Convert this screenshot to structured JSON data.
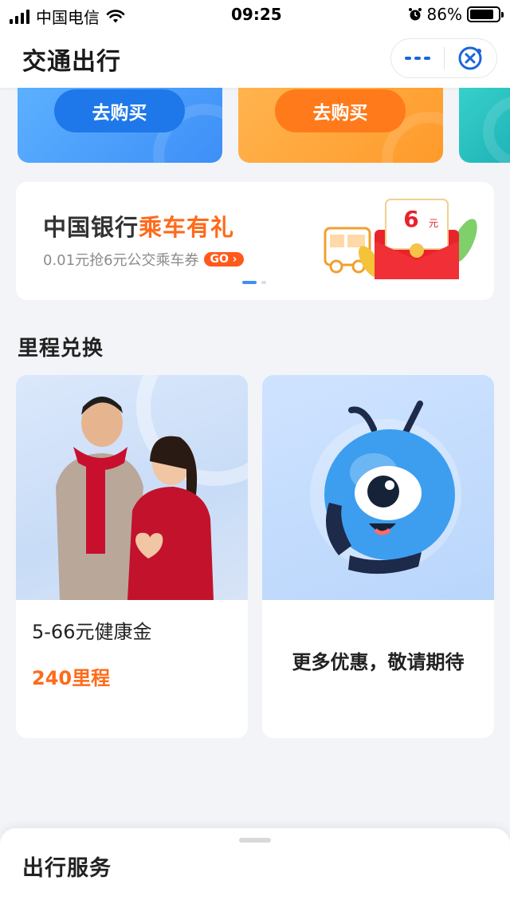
{
  "status_bar": {
    "carrier": "中国电信",
    "time": "09:25",
    "battery_percent": "86%",
    "battery_level": 0.86,
    "icons": [
      "signal-icon",
      "wifi-icon",
      "alarm-icon",
      "battery-icon"
    ]
  },
  "header": {
    "title": "交通出行",
    "more_icon": "more-dots-icon",
    "close_icon": "close-miniprogram-icon",
    "accent": "#1b66d9"
  },
  "tickets": [
    {
      "button_label": "去购买",
      "color": "#3d8ff7"
    },
    {
      "button_label": "去购买",
      "color": "#ff9a2a"
    },
    {
      "color": "#1fb3b8"
    }
  ],
  "banner": {
    "title_prefix": "中国银行",
    "title_highlight": "乘车有礼",
    "subtitle": "0.01元抢6元公交乘车券",
    "go_label": "GO",
    "art_amount": "6",
    "art_unit": "元",
    "highlight_color": "#ff6a1a",
    "slides_total": 2,
    "active_slide": 1
  },
  "section": {
    "title": "里程兑换"
  },
  "exchange": [
    {
      "name": "5-66元健康金",
      "price": "240里程",
      "image": "couple-photo"
    },
    {
      "coming_soon": "更多优惠，敬请期待",
      "image": "ant-mascot-illustration"
    }
  ],
  "bottom_sheet": {
    "title": "出行服务"
  }
}
